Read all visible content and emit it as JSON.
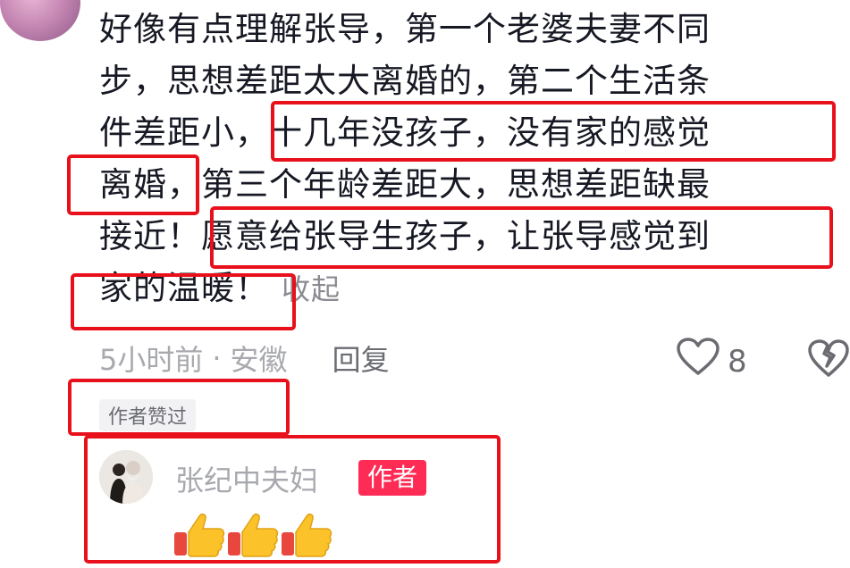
{
  "comment": {
    "line1": "好像有点理解张导，第一个老婆夫妻不同",
    "line2": "步，思想差距太大离婚的，第二个生活条",
    "line3a": "件差距小，",
    "line3b": "十几年没孩子，没有家的感觉",
    "line4a": "离婚，",
    "line4b": "第三个年龄差距大，思想差距缺最",
    "line5a": "接近！",
    "line5b": "愿意给张导生孩子，让张导感觉到",
    "line6a": "家的温暖！",
    "collapse": "收起"
  },
  "meta": {
    "time": "5小时前",
    "separator": "·",
    "location": "安徽",
    "reply": "回复",
    "likes": "8"
  },
  "author_liked": "作者赞过",
  "reply": {
    "name": "张纪中夫妇",
    "tag": "作者",
    "emojis": [
      "thumbs-up",
      "thumbs-up",
      "thumbs-up"
    ]
  },
  "colors": {
    "highlight_box": "#e8101b",
    "author_tag": "#fe2c55",
    "text": "#161823"
  }
}
